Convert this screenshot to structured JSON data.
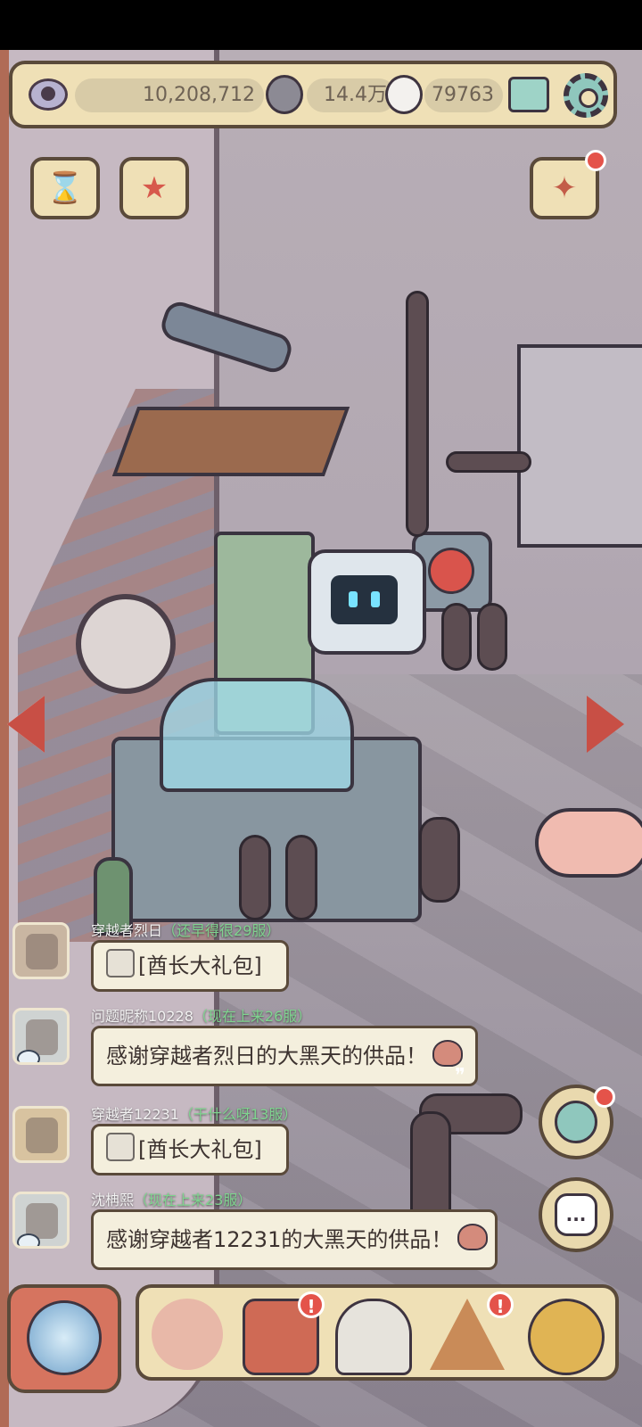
{
  "topbar": {
    "eye_count": "10,208,712",
    "dark_orb_count": "14.4万",
    "light_orb_count": "79763",
    "icons": [
      "eye-icon",
      "dark-soul-icon",
      "light-soul-icon",
      "mail-icon",
      "gear-icon"
    ]
  },
  "corner_buttons": {
    "left": [
      "hourglass-icon",
      "star-badge-icon"
    ],
    "right": [
      "party-popper-icon"
    ]
  },
  "chat": [
    {
      "user": "穿越者烈日",
      "server": "（还早得很29服）",
      "message": "[酋长大礼包]",
      "type": "gift"
    },
    {
      "user": "问题昵称10228",
      "server": "（现在上来26服）",
      "message": "感谢穿越者烈日的大黑天的供品！",
      "type": "thanks"
    },
    {
      "user": "穿越者12231",
      "server": "（干什么呀13服）",
      "message": "[酋长大礼包]",
      "type": "gift"
    },
    {
      "user": "沈柟熙",
      "server": "（现在上来23服）",
      "message": "感谢穿越者12231的大黑天的供品！",
      "type": "thanks"
    }
  ],
  "side_buttons": {
    "chat_label": "...",
    "icons": [
      "portal-icon",
      "chat-bubble-icon"
    ]
  },
  "dock": {
    "items": [
      "snail-icon",
      "toolbox-icon",
      "bust-statue-icon",
      "pyramid-eye-icon",
      "key-coin-icon"
    ],
    "alerts": [
      "!",
      "!"
    ]
  },
  "colors": {
    "panel": "#efe0b6",
    "border": "#5a4a3a",
    "server_text": "#7fd48f",
    "alert": "#e4534a"
  }
}
